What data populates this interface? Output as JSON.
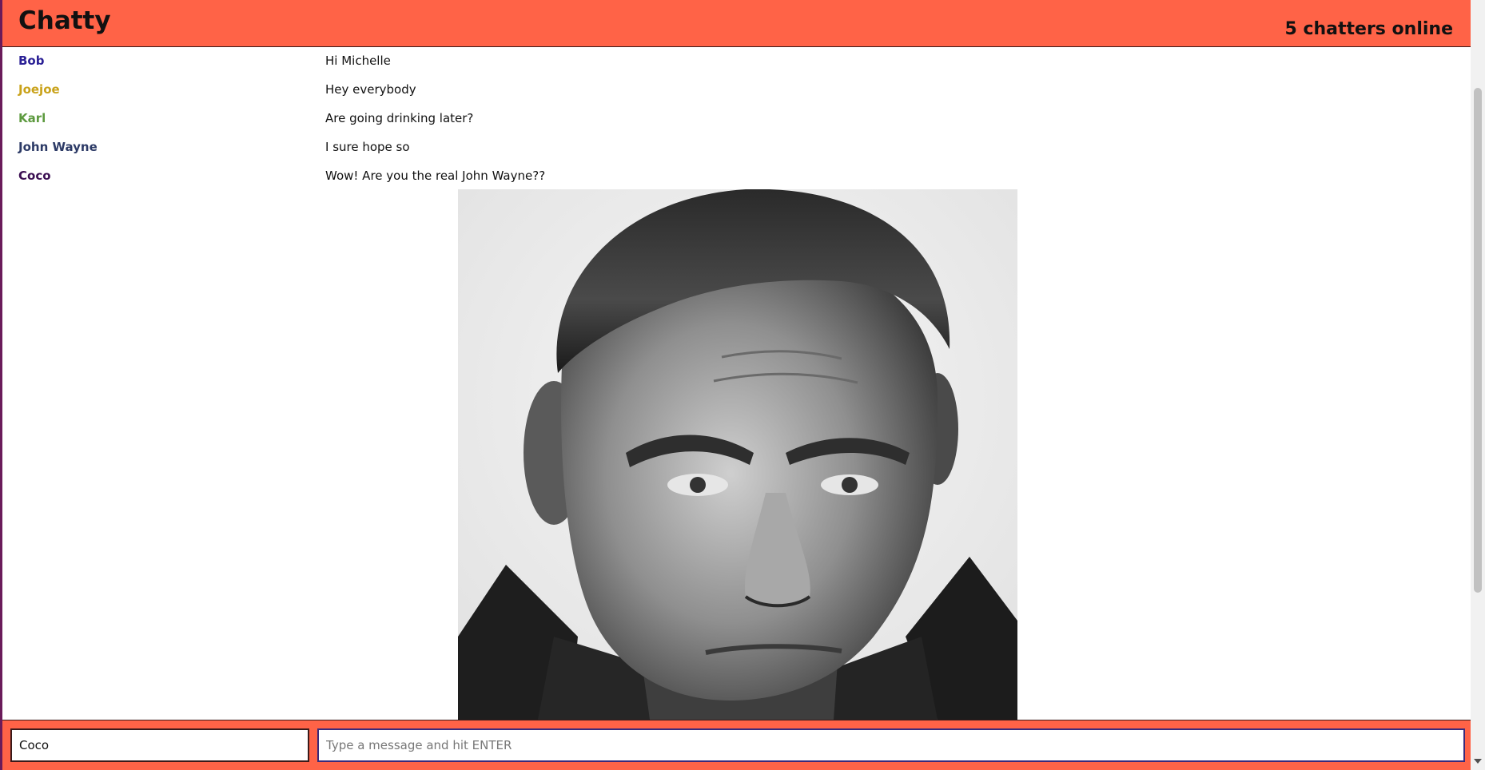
{
  "header": {
    "title": "Chatty",
    "online_count": "5 chatters online",
    "background_color": "#ff6347"
  },
  "messages": [
    {
      "author": "Bob",
      "text": "Hi Michelle",
      "color": "#2b2196"
    },
    {
      "author": "Joejoe",
      "text": "Hey everybody",
      "color": "#c9a21a"
    },
    {
      "author": "Karl",
      "text": "Are going drinking later?",
      "color": "#5d9a3f"
    },
    {
      "author": "John Wayne",
      "text": "I sure hope so",
      "color": "#2c3a66"
    },
    {
      "author": "Coco",
      "text": "Wow! Are you the real John Wayne??",
      "color": "#3b0f52"
    }
  ],
  "footer": {
    "name_value": "Coco",
    "message_placeholder": "Type a message and hit ENTER",
    "message_value": ""
  }
}
